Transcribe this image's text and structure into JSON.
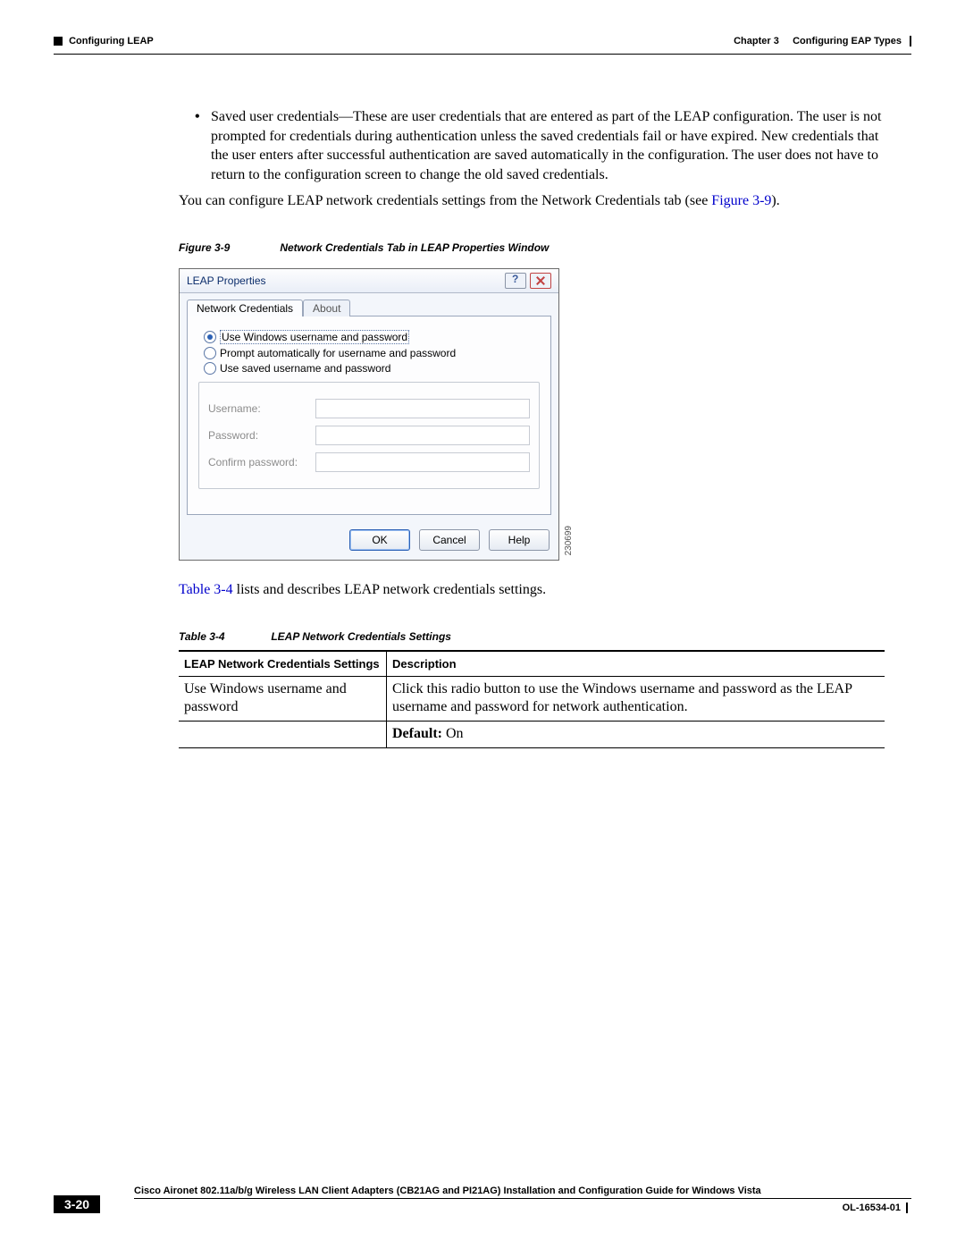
{
  "header": {
    "left": "Configuring LEAP",
    "right_prefix": "Chapter 3",
    "right_suffix": "Configuring EAP Types"
  },
  "bullet": {
    "text": "Saved user credentials—These are user credentials that are entered as part of the LEAP configuration. The user is not prompted for credentials during authentication unless the saved credentials fail or have expired. New credentials that the user enters after successful authentication are saved automatically in the configuration. The user does not have to return to the configuration screen to change the old saved credentials."
  },
  "para1_pre": "You can configure LEAP network credentials settings from the Network Credentials tab (see ",
  "para1_link": "Figure 3-9",
  "para1_post": ").",
  "figure": {
    "num": "Figure 3-9",
    "title": "Network Credentials Tab in LEAP Properties Window"
  },
  "dialog": {
    "title": "LEAP Properties",
    "tabs": {
      "active": "Network Credentials",
      "other": "About"
    },
    "radios": {
      "r1": "Use Windows username and password",
      "r2": "Prompt automatically for username and password",
      "r3": "Use saved username and password"
    },
    "fields": {
      "username": "Username:",
      "password": "Password:",
      "confirm": "Confirm password:"
    },
    "buttons": {
      "ok": "OK",
      "cancel": "Cancel",
      "help": "Help"
    },
    "imgid": "230699"
  },
  "para2_link": "Table 3-4",
  "para2_rest": " lists and describes LEAP network credentials settings.",
  "table_caption": {
    "num": "Table 3-4",
    "title": "LEAP Network Credentials Settings"
  },
  "table": {
    "h1": "LEAP Network Credentials Settings",
    "h2": "Description",
    "r1c1": "Use Windows username and password",
    "r1c2": "Click this radio button to use the Windows username and password as the LEAP username and password for network authentication.",
    "r2c2_bold": "Default:",
    "r2c2_rest": " On"
  },
  "footer": {
    "title": "Cisco Aironet 802.11a/b/g Wireless LAN Client Adapters (CB21AG and PI21AG) Installation and Configuration Guide for Windows Vista",
    "page": "3-20",
    "docid": "OL-16534-01"
  }
}
